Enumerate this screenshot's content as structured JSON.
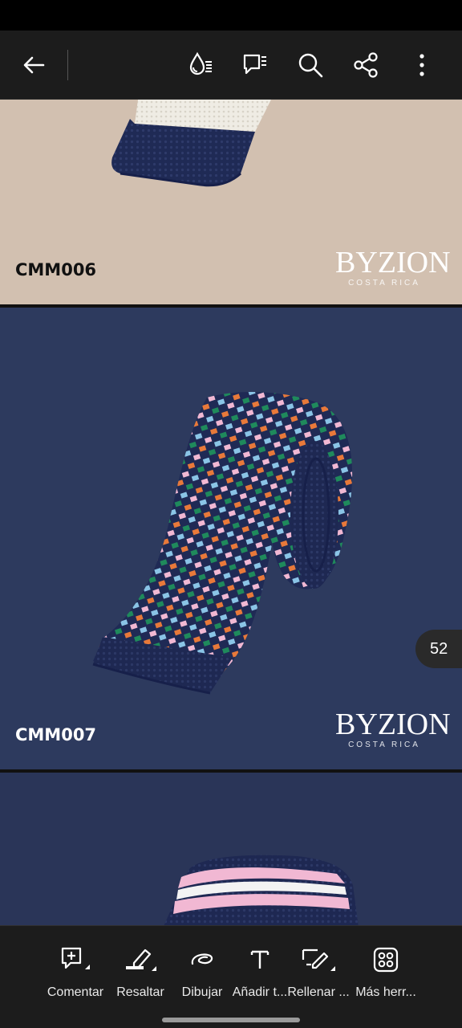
{
  "toolbar": {
    "back": "back-arrow-icon",
    "read_aloud": "liquid-mode-icon",
    "comments": "comments-icon",
    "search": "search-icon",
    "share": "share-icon",
    "more": "more-vertical-icon"
  },
  "pages": [
    {
      "code": "CMM006",
      "brand_logo": "BYZION",
      "brand_sub": "COSTA RICA",
      "background": "#d2c0b0"
    },
    {
      "code": "CMM007",
      "brand_logo": "BYZION",
      "brand_sub": "COSTA RICA",
      "background": "#2d3a5e"
    },
    {
      "background": "#2a3558"
    }
  ],
  "page_indicator": "52",
  "bottom_tools": [
    {
      "label": "Comentar",
      "icon": "add-comment-icon"
    },
    {
      "label": "Resaltar",
      "icon": "highlight-icon"
    },
    {
      "label": "Dibujar",
      "icon": "draw-icon"
    },
    {
      "label": "Añadir t...",
      "icon": "add-text-icon"
    },
    {
      "label": "Rellenar ...",
      "icon": "fill-sign-icon"
    },
    {
      "label": "Más herr...",
      "icon": "more-tools-icon"
    }
  ],
  "colors": {
    "bar_background": "#1c1c1c",
    "tie_navy": "#1f2a55",
    "accent_orange": "#e8793a",
    "accent_green": "#1f8a5c",
    "accent_blue": "#8ac4e6",
    "accent_pink": "#f1b8d3"
  }
}
